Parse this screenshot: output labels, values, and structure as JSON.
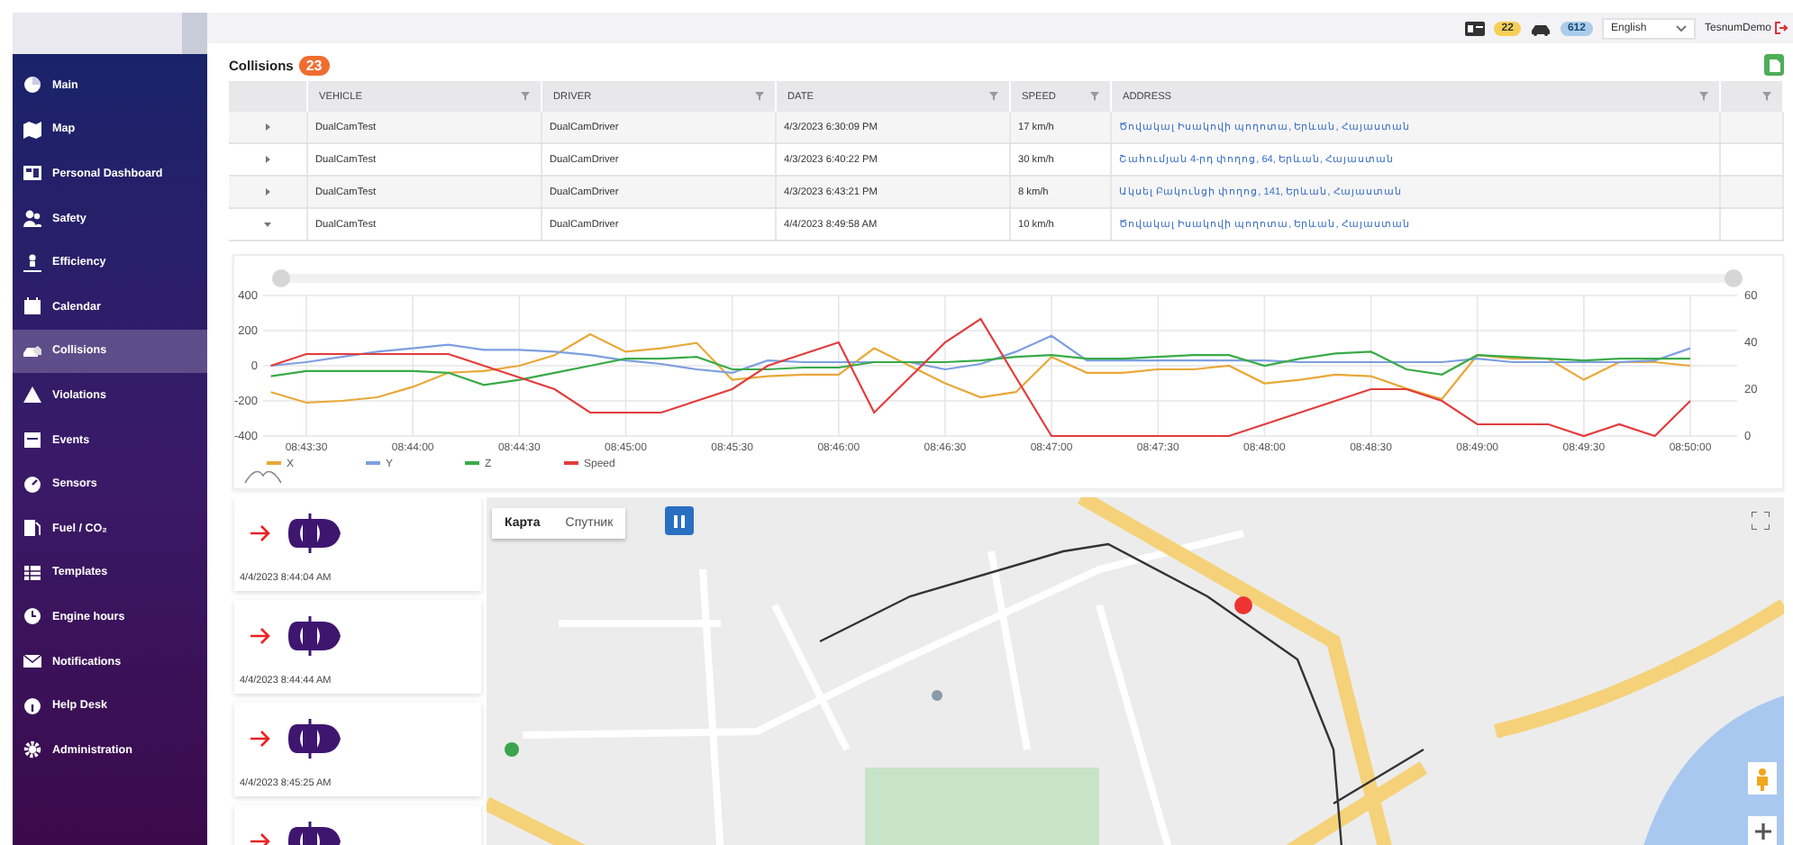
{
  "header": {
    "alerts_count": "22",
    "vehicles_count": "612",
    "language": "English",
    "user": "TesnumDemo"
  },
  "sidebar": {
    "items": [
      {
        "label": "Main",
        "selected": false
      },
      {
        "label": "Map",
        "selected": false
      },
      {
        "label": "Personal Dashboard",
        "selected": false
      },
      {
        "label": "Safety",
        "selected": false
      },
      {
        "label": "Efficiency",
        "selected": false
      },
      {
        "label": "Calendar",
        "selected": false
      },
      {
        "label": "Collisions",
        "selected": true
      },
      {
        "label": "Violations",
        "selected": false
      },
      {
        "label": "Events",
        "selected": false
      },
      {
        "label": "Sensors",
        "selected": false
      },
      {
        "label": "Fuel / CO₂",
        "selected": false
      },
      {
        "label": "Templates",
        "selected": false
      },
      {
        "label": "Engine hours",
        "selected": false
      },
      {
        "label": "Notifications",
        "selected": false
      },
      {
        "label": "Help Desk",
        "selected": false
      },
      {
        "label": "Administration",
        "selected": false
      }
    ]
  },
  "page": {
    "title": "Collisions",
    "count": "23"
  },
  "table": {
    "columns": [
      {
        "label": "VEHICLE",
        "filter": true
      },
      {
        "label": "DRIVER",
        "filter": true
      },
      {
        "label": "DATE",
        "filter": true
      },
      {
        "label": "SPEED",
        "filter": true
      },
      {
        "label": "ADDRESS",
        "filter": true
      },
      {
        "filter": true
      }
    ],
    "rows": [
      {
        "expanded": false,
        "cells": [
          "DualCamTest",
          "DualCamDriver",
          "4/3/2023 6:30:09 PM",
          "17 km/h",
          "Ծովակալ Իսակովի պողոտա, Երևան, Հայաստան"
        ]
      },
      {
        "expanded": false,
        "cells": [
          "DualCamTest",
          "DualCamDriver",
          "4/3/2023 6:40:22 PM",
          "30 km/h",
          "Շահումյան 4-րդ փողոց, 64, Երևան, Հայաստան"
        ]
      },
      {
        "expanded": false,
        "cells": [
          "DualCamTest",
          "DualCamDriver",
          "4/3/2023 6:43:21 PM",
          "8 km/h",
          "Ակսել Բակունցի փողոց, 141, Երևան, Հայաստան"
        ]
      },
      {
        "expanded": true,
        "cells": [
          "DualCamTest",
          "DualCamDriver",
          "4/4/2023 8:49:58 AM",
          "10 km/h",
          "Ծովակալ Իսակովի պողոտա, Երևան, Հայաստան"
        ]
      }
    ]
  },
  "chart": {
    "chart_data": {
      "type": "line",
      "categories": [
        null,
        "08:43:30",
        null,
        null,
        "08:44:00",
        null,
        null,
        "08:44:30",
        null,
        null,
        "08:45:00",
        null,
        null,
        "08:45:30",
        null,
        null,
        "08:46:00",
        null,
        null,
        "08:46:30",
        null,
        null,
        "08:47:00",
        null,
        null,
        "08:47:30",
        null,
        null,
        "08:48:00",
        null,
        null,
        "08:48:30",
        null,
        null,
        "08:49:00",
        null,
        null,
        "08:49:30",
        null,
        null,
        "08:50:00"
      ],
      "ylim": [
        -400,
        400
      ],
      "y2lim": [
        0,
        60
      ],
      "grid": true,
      "legend": "bottom-left",
      "yticks": [
        400,
        200,
        0,
        -200,
        -400
      ],
      "y2ticks": [
        60,
        40,
        20,
        0
      ],
      "series": [
        {
          "name": "X",
          "color": "#e8a838",
          "values": [
            -150,
            -210,
            -200,
            -180,
            -120,
            -40,
            -30,
            0,
            60,
            180,
            80,
            100,
            130,
            -80,
            -60,
            -50,
            -50,
            100,
            0,
            -100,
            -180,
            -150,
            50,
            -40,
            -40,
            -20,
            -20,
            0,
            -100,
            -80,
            -50,
            -60,
            -130,
            -190,
            60,
            40,
            40,
            -80,
            20,
            20,
            0
          ]
        },
        {
          "name": "Y",
          "color": "#7d9fe0",
          "values": [
            0,
            20,
            50,
            80,
            100,
            120,
            90,
            90,
            80,
            60,
            30,
            10,
            -20,
            -40,
            30,
            20,
            20,
            20,
            20,
            -20,
            10,
            80,
            170,
            30,
            30,
            30,
            30,
            30,
            30,
            20,
            20,
            20,
            20,
            20,
            40,
            20,
            20,
            20,
            20,
            30,
            100
          ]
        },
        {
          "name": "Z",
          "color": "#3aaa48",
          "values": [
            -60,
            -30,
            -30,
            -30,
            -30,
            -40,
            -110,
            -80,
            -40,
            0,
            40,
            40,
            50,
            -20,
            -20,
            -10,
            -10,
            20,
            20,
            20,
            30,
            50,
            60,
            40,
            40,
            50,
            60,
            60,
            0,
            40,
            70,
            80,
            -20,
            -50,
            60,
            50,
            40,
            30,
            40,
            40,
            40
          ]
        },
        {
          "name": "Speed",
          "color": "#e23c3c",
          "axis": "y2",
          "values": [
            30,
            35,
            35,
            35,
            35,
            35,
            30,
            25,
            20,
            10,
            10,
            10,
            15,
            20,
            30,
            35,
            40,
            10,
            25,
            40,
            50,
            25,
            0,
            0,
            0,
            0,
            0,
            0,
            5,
            10,
            15,
            20,
            20,
            15,
            5,
            5,
            5,
            0,
            5,
            0,
            15
          ]
        }
      ]
    }
  },
  "events": [
    {
      "kind": "front-impact",
      "time": "4/4/2023 8:44:04 AM"
    },
    {
      "kind": "front-impact",
      "time": "4/4/2023 8:44:44 AM"
    },
    {
      "kind": "front-impact",
      "time": "4/4/2023 8:45:25 AM"
    },
    {
      "kind": "front-impact"
    }
  ],
  "map": {
    "tabs": [
      {
        "label": "Карта",
        "selected": true
      },
      {
        "label": "Спутник",
        "selected": false
      }
    ]
  }
}
